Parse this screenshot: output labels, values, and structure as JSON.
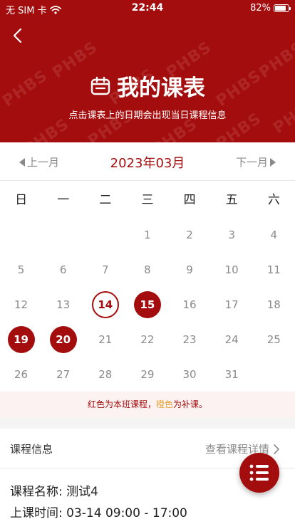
{
  "status_bar": {
    "carrier": "无 SIM 卡",
    "time": "22:44",
    "battery": "82%",
    "battery_level": 0.82
  },
  "header": {
    "title": "我的课表",
    "subtitle": "点击课表上的日期会出现当日课程信息",
    "watermark": "PHBS",
    "back_icon": "chevron-left-icon",
    "title_icon": "calendar-icon"
  },
  "month_nav": {
    "prev_label": "上一月",
    "next_label": "下一月",
    "current": "2023年03月"
  },
  "weekdays": [
    "日",
    "一",
    "二",
    "三",
    "四",
    "五",
    "六"
  ],
  "calendar": {
    "weeks": [
      [
        {
          "d": ""
        },
        {
          "d": ""
        },
        {
          "d": ""
        },
        {
          "d": "1"
        },
        {
          "d": "2"
        },
        {
          "d": "3"
        },
        {
          "d": "4"
        }
      ],
      [
        {
          "d": "5"
        },
        {
          "d": "6"
        },
        {
          "d": "7"
        },
        {
          "d": "8"
        },
        {
          "d": "9"
        },
        {
          "d": "10"
        },
        {
          "d": "11"
        }
      ],
      [
        {
          "d": "12"
        },
        {
          "d": "13"
        },
        {
          "d": "14",
          "state": "ring"
        },
        {
          "d": "15",
          "state": "filled"
        },
        {
          "d": "16"
        },
        {
          "d": "17"
        },
        {
          "d": "18"
        }
      ],
      [
        {
          "d": "19",
          "state": "filled"
        },
        {
          "d": "20",
          "state": "filled"
        },
        {
          "d": "21"
        },
        {
          "d": "22"
        },
        {
          "d": "23"
        },
        {
          "d": "24"
        },
        {
          "d": "25"
        }
      ],
      [
        {
          "d": "26"
        },
        {
          "d": "27"
        },
        {
          "d": "28"
        },
        {
          "d": "29"
        },
        {
          "d": "30"
        },
        {
          "d": "31"
        },
        {
          "d": ""
        }
      ]
    ]
  },
  "legend": {
    "part1": "红色为本班课程，",
    "part2": "橙色",
    "part3": "为补课。"
  },
  "course_info": {
    "title": "课程信息",
    "detail_link": "查看课程详情",
    "name_label": "课程名称:",
    "name_value": "测试4",
    "time_label": "上课时间:",
    "time_value": "03-14 09:00 - 17:00"
  },
  "fab": {
    "icon": "menu-list-icon"
  },
  "colors": {
    "primary": "#a40d0d",
    "orange": "#e6a23c",
    "muted": "#8a8a8a"
  }
}
